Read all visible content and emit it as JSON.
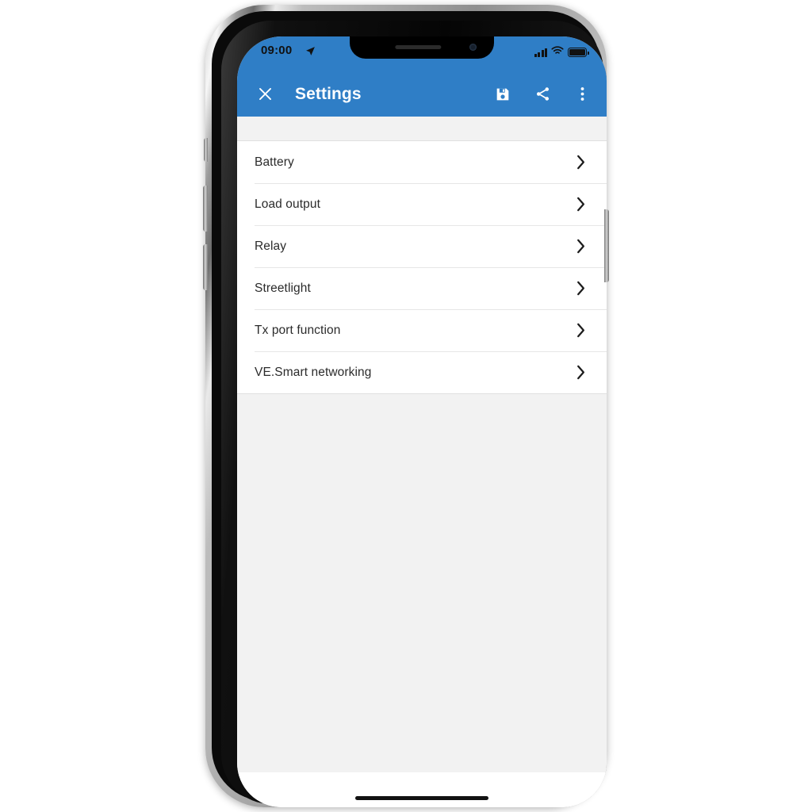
{
  "theme": {
    "app_bar_color": "#2f7ec6",
    "screen_background": "#f2f2f2",
    "list_background": "#ffffff",
    "divider_color": "#e6e6e6",
    "text_color": "#2b2b2b",
    "status_icon_color": "#111111"
  },
  "status_bar": {
    "time": "09:00",
    "location_icon": "location-arrow-icon",
    "signal_icon": "cellular-signal-icon",
    "signal_bars": 4,
    "wifi_icon": "wifi-icon",
    "battery_icon": "battery-full-icon"
  },
  "app_bar": {
    "close_label": "close-icon",
    "title": "Settings",
    "actions": [
      {
        "name": "save-button",
        "icon": "save-icon"
      },
      {
        "name": "share-button",
        "icon": "share-icon"
      },
      {
        "name": "overflow-menu-button",
        "icon": "more-vertical-icon"
      }
    ]
  },
  "settings_list": {
    "items": [
      {
        "label": "Battery",
        "chevron": "chevron-right-icon"
      },
      {
        "label": "Load output",
        "chevron": "chevron-right-icon"
      },
      {
        "label": "Relay",
        "chevron": "chevron-right-icon"
      },
      {
        "label": "Streetlight",
        "chevron": "chevron-right-icon"
      },
      {
        "label": "Tx port function",
        "chevron": "chevron-right-icon"
      },
      {
        "label": "VE.Smart networking",
        "chevron": "chevron-right-icon"
      }
    ]
  },
  "device_frame": {
    "notch_speaker": "earpiece-speaker",
    "notch_camera": "front-camera",
    "home_indicator": "home-indicator",
    "buttons": [
      "mute-switch",
      "volume-up-button",
      "volume-down-button",
      "power-button"
    ]
  }
}
